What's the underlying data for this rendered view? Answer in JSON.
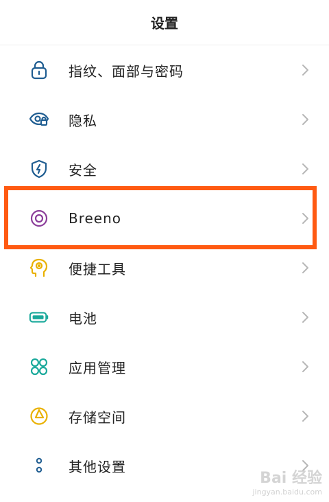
{
  "header": {
    "title": "设置"
  },
  "settings": {
    "items": [
      {
        "label": "指纹、面部与密码",
        "icon": "lock-icon",
        "color": "#1f5d91"
      },
      {
        "label": "隐私",
        "icon": "privacy-eye-icon",
        "color": "#1f5d91"
      },
      {
        "label": "安全",
        "icon": "shield-icon",
        "color": "#1f5d91"
      },
      {
        "label": "Breeno",
        "icon": "breeno-ring-icon",
        "color": "#8b3d9a"
      },
      {
        "label": "便捷工具",
        "icon": "smart-head-icon",
        "color": "#e9b100"
      },
      {
        "label": "电池",
        "icon": "battery-icon",
        "color": "#1aa99b"
      },
      {
        "label": "应用管理",
        "icon": "app-grid-icon",
        "color": "#1aa99b"
      },
      {
        "label": "存储空间",
        "icon": "storage-pie-icon",
        "color": "#e9b100"
      },
      {
        "label": "其他设置",
        "icon": "more-dots-icon",
        "color": "#1f5d91"
      }
    ],
    "highlighted_item": "Breeno",
    "highlight_color": "#ff5a12"
  },
  "watermark": {
    "main": "Bai 经验",
    "sub": "jingyan.baidu.com"
  }
}
